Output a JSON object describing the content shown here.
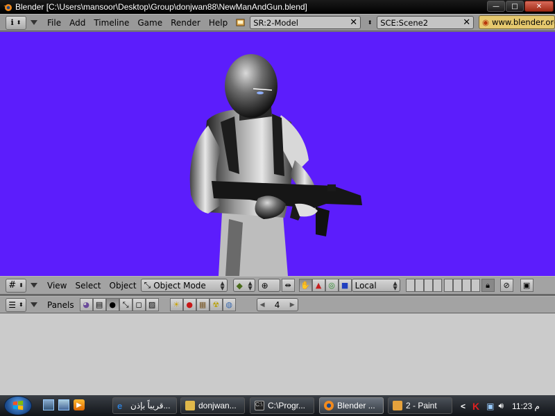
{
  "window": {
    "title": "Blender [C:\\Users\\mansoor\\Desktop\\Group\\donjwan88\\NewManAndGun.blend]",
    "buttons": {
      "minimize": "—",
      "maximize": "□",
      "close": "✕"
    }
  },
  "top_header": {
    "menus": [
      "File",
      "Add",
      "Timeline",
      "Game",
      "Render",
      "Help"
    ],
    "screen_field": "SR:2-Model",
    "scene_field": "SCE:Scene2",
    "url": "www.blender.org"
  },
  "view_header": {
    "menus": [
      "View",
      "Select",
      "Object"
    ],
    "mode": "Object Mode",
    "orientation": "Local"
  },
  "buttons_header": {
    "panels_label": "Panels",
    "frame": "4"
  },
  "taskbar": {
    "tasks": [
      {
        "label": "قريباً بإذن...",
        "color": "#2f7fd6"
      },
      {
        "label": "donjwan...",
        "color": "#e0b84a"
      },
      {
        "label": "C:\\Progr...",
        "color": "#222222"
      },
      {
        "label": "Blender ...",
        "color": "#f08a1e",
        "active": true
      },
      {
        "label": "2 - Paint",
        "color": "#e6a23c"
      }
    ],
    "clock": "11:23 م",
    "chevron": "<"
  },
  "colors": {
    "viewport_bg": "#5c1dfc",
    "header_bg": "#999999",
    "panel_bg": "#cbcbcb"
  }
}
